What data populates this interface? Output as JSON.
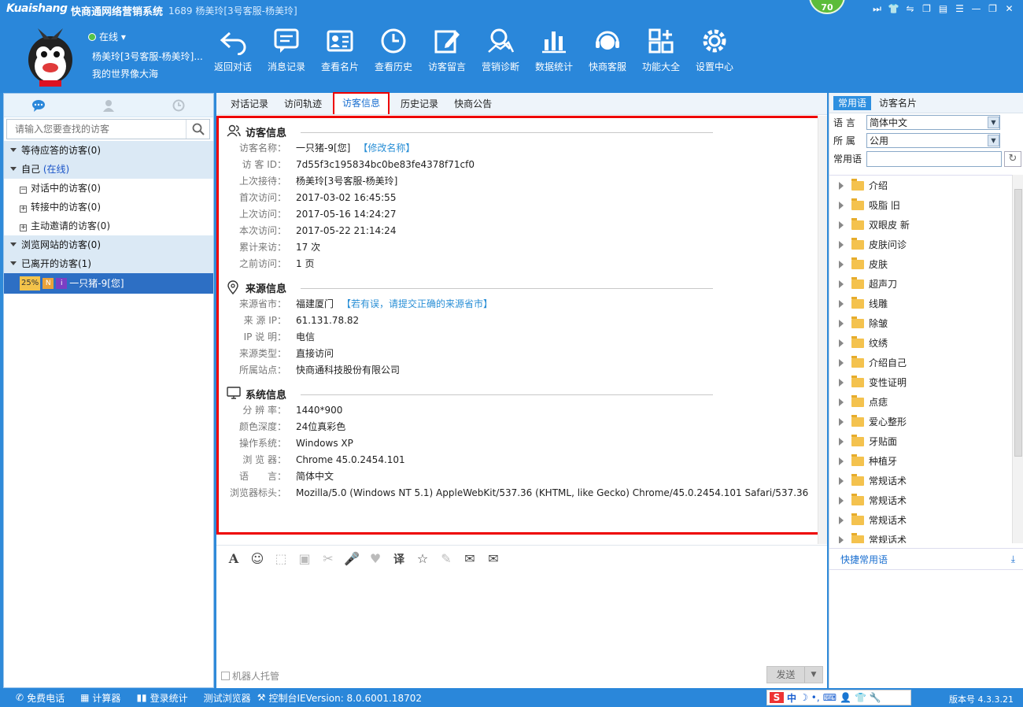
{
  "titlebar": {
    "logo": "Kuaishang",
    "app_name": "快商通网络营销系统",
    "session": "1689 杨美玲[3号客服-杨美玲]",
    "score": "70"
  },
  "profile": {
    "status": "在线",
    "name": "杨美玲[3号客服-杨美玲]...",
    "motto": "我的世界像大海"
  },
  "toolbar": [
    {
      "label": "返回对话",
      "icon": "return-icon"
    },
    {
      "label": "消息记录",
      "icon": "message-record-icon"
    },
    {
      "label": "查看名片",
      "icon": "card-icon"
    },
    {
      "label": "查看历史",
      "icon": "clock-icon"
    },
    {
      "label": "访客留言",
      "icon": "edit-icon"
    },
    {
      "label": "营销诊断",
      "icon": "diagnosis-icon"
    },
    {
      "label": "数据统计",
      "icon": "bar-chart-icon"
    },
    {
      "label": "快商客服",
      "icon": "headset-icon"
    },
    {
      "label": "功能大全",
      "icon": "grid-plus-icon"
    },
    {
      "label": "设置中心",
      "icon": "gear-icon"
    }
  ],
  "left": {
    "search_placeholder": "请输入您要查找的访客",
    "groups": {
      "waiting": "等待应答的访客(0)",
      "self": "自己",
      "self_status": "(在线)",
      "talking": "对话中的访客(0)",
      "transferring": "转接中的访客(0)",
      "inviting": "主动邀请的访客(0)",
      "browsing": "浏览网站的访客(0)",
      "left": "已离开的访客(1)"
    },
    "visitor": {
      "pct": "25%",
      "name": "一只猪-9[您]"
    }
  },
  "center": {
    "tabs": [
      "对话记录",
      "访问轨迹",
      "访客信息",
      "历史记录",
      "快商公告"
    ],
    "visitor_info": {
      "title": "访客信息",
      "rows": [
        {
          "k": "访客名称：",
          "v": "一只猪-9[您]",
          "link": "【修改名称】"
        },
        {
          "k": "访 客 ID：",
          "v": "7d55f3c195834bc0be83fe4378f71cf0"
        },
        {
          "k": "上次接待：",
          "v": "杨美玲[3号客服-杨美玲]"
        },
        {
          "k": "首次访问：",
          "v": "2017-03-02 16:45:55"
        },
        {
          "k": "上次访问：",
          "v": "2017-05-16 14:24:27"
        },
        {
          "k": "本次访问：",
          "v": "2017-05-22 21:14:24"
        },
        {
          "k": "累计来访：",
          "v": "17 次"
        },
        {
          "k": "之前访问：",
          "v": "1 页"
        }
      ]
    },
    "source_info": {
      "title": "来源信息",
      "rows": [
        {
          "k": "来源省市：",
          "v": "福建厦门",
          "link": "【若有误，请提交正确的来源省市】"
        },
        {
          "k": "来 源 IP：",
          "v": "61.131.78.82"
        },
        {
          "k": "IP 说 明：",
          "v": "电信"
        },
        {
          "k": "来源类型：",
          "v": "直接访问"
        },
        {
          "k": "所属站点：",
          "v": "快商通科技股份有限公司"
        }
      ]
    },
    "system_info": {
      "title": "系统信息",
      "rows": [
        {
          "k": "分 辨 率：",
          "v": "1440*900"
        },
        {
          "k": "颜色深度：",
          "v": "24位真彩色"
        },
        {
          "k": "操作系统：",
          "v": "Windows XP"
        },
        {
          "k": "浏 览 器：",
          "v": "Chrome 45.0.2454.101"
        },
        {
          "k": "语　　言：",
          "v": "简体中文"
        },
        {
          "k": "浏览器标头：",
          "v": "Mozilla/5.0 (Windows NT 5.1) AppleWebKit/537.36 (KHTML, like Gecko) Chrome/45.0.2454.101 Safari/537.36"
        }
      ]
    },
    "robot": "机器人托管",
    "send": "发送"
  },
  "right": {
    "tabs": [
      "常用语",
      "访客名片"
    ],
    "language_label": "语 言",
    "language_value": "简体中文",
    "owner_label": "所 属",
    "owner_value": "公用",
    "phrase_label": "常用语",
    "folders": [
      "介绍",
      "吸脂 旧",
      "双眼皮 新",
      "皮肤问诊",
      "皮肤",
      "超声刀",
      "线雕",
      "除皱",
      "纹绣",
      "介绍自己",
      "变性证明",
      "点痣",
      "爱心整形",
      "牙贴面",
      "种植牙",
      "常规话术",
      "常规话术",
      "常规话术",
      "常规话术"
    ],
    "quick": "快捷常用语"
  },
  "statusbar": {
    "items": [
      "免费电话",
      "计算器",
      "登录统计",
      "测试浏览器",
      "控制台IEVersion: 8.0.6001.18702"
    ],
    "ime_lang": "中",
    "version": "版本号 4.3.3.21"
  }
}
